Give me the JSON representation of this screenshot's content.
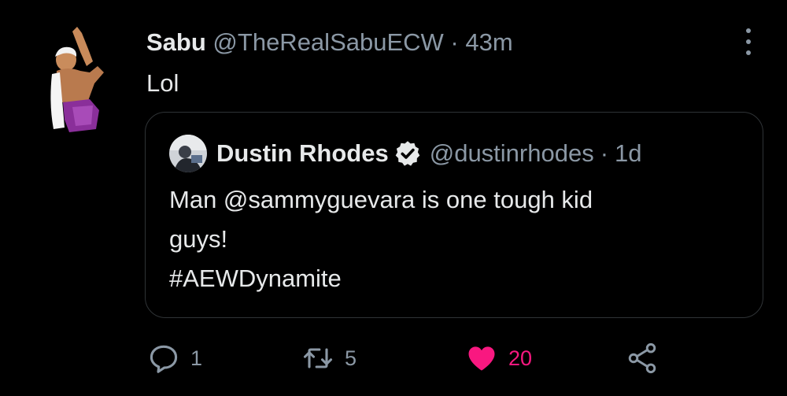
{
  "tweet": {
    "name": "Sabu",
    "handle": "@TheRealSabuECW",
    "separator": "·",
    "time": "43m",
    "text": "Lol",
    "avatar_icon": "sabu-avatar",
    "more_icon": "more-options-icon"
  },
  "quote": {
    "name": "Dustin Rhodes",
    "verified_icon": "verified-badge-icon",
    "handle": "@dustinrhodes",
    "separator": "·",
    "time": "1d",
    "text_lines": [
      "Man @sammyguevara is one tough kid",
      "guys!",
      "#AEWDynamite"
    ]
  },
  "actions": {
    "reply_count": "1",
    "retweet_count": "5",
    "like_count": "20",
    "share_icon": "share-icon"
  },
  "colors": {
    "background": "#000000",
    "text_primary": "#e7e9ea",
    "text_secondary": "#8b98a5",
    "border": "#2f3336",
    "like": "#f91880"
  }
}
